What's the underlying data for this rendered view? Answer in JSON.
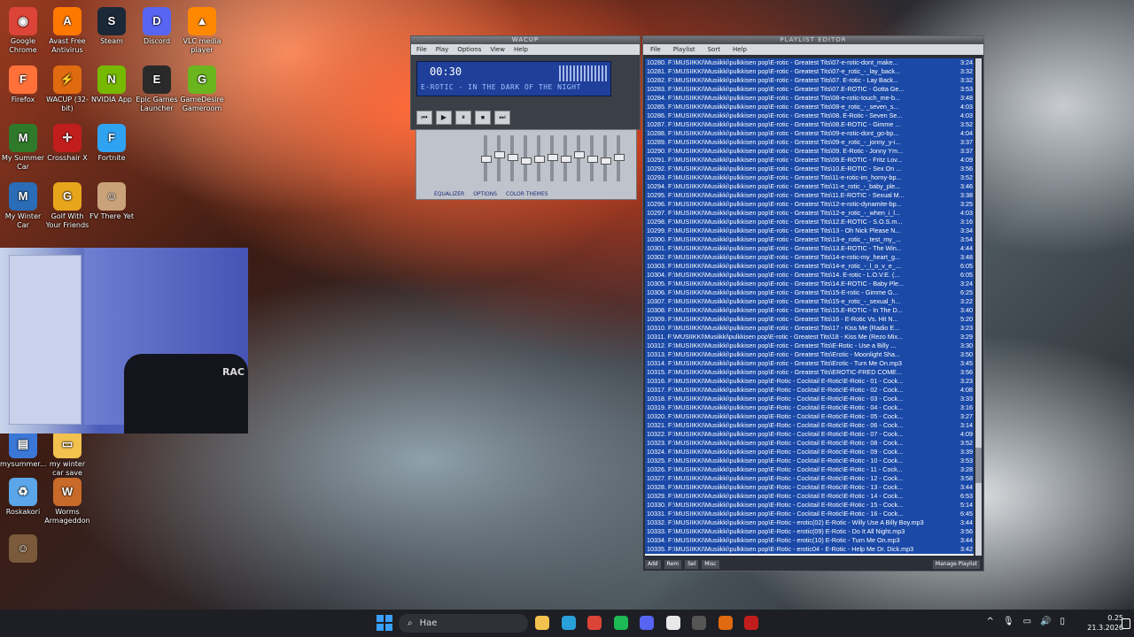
{
  "desktop": {
    "icons": [
      {
        "label": "Google Chrome",
        "icon": "chrome-icon",
        "color": "#db4437",
        "glyph": "◉"
      },
      {
        "label": "Avast Free Antivirus",
        "icon": "avast-icon",
        "color": "#ff7800",
        "glyph": "A"
      },
      {
        "label": "Steam",
        "icon": "steam-icon",
        "color": "#1b2838",
        "glyph": "S"
      },
      {
        "label": "Discord",
        "icon": "discord-icon",
        "color": "#5865f2",
        "glyph": "D"
      },
      {
        "label": "VLC media player",
        "icon": "vlc-icon",
        "color": "#ff8800",
        "glyph": "▲"
      },
      {
        "label": "Firefox",
        "icon": "firefox-icon",
        "color": "#ff7139",
        "glyph": "F"
      },
      {
        "label": "WACUP (32-bit)",
        "icon": "wacup-icon",
        "color": "#e06a10",
        "glyph": "⚡"
      },
      {
        "label": "NVIDIA App",
        "icon": "nvidia-icon",
        "color": "#76b900",
        "glyph": "N"
      },
      {
        "label": "Epic Games Launcher",
        "icon": "epic-icon",
        "color": "#2a2a2a",
        "glyph": "E"
      },
      {
        "label": "GameDesire Gameroom",
        "icon": "gamedesire-icon",
        "color": "#6bb51f",
        "glyph": "G"
      },
      {
        "label": "My Summer Car",
        "icon": "mysummercar-icon",
        "color": "#2f7a2a",
        "glyph": "M"
      },
      {
        "label": "Crosshair X",
        "icon": "crosshair-icon",
        "color": "#c21d1d",
        "glyph": "✛"
      },
      {
        "label": "Fortnite",
        "icon": "fortnite-icon",
        "color": "#2fa3f2",
        "glyph": "F"
      },
      {
        "label": "My Winter Car",
        "icon": "mywintercar-icon",
        "color": "#2a6cb5",
        "glyph": "M"
      },
      {
        "label": "Golf With Your Friends",
        "icon": "golf-icon",
        "color": "#e7a51c",
        "glyph": "G"
      },
      {
        "label": "FV There Yet",
        "icon": "game-icon",
        "color": "#c9a27a",
        "glyph": "☺"
      },
      {
        "label": "mysummer...",
        "icon": "file-icon",
        "color": "#3a77d6",
        "glyph": "▤"
      },
      {
        "label": "my winter car save",
        "icon": "folder-icon",
        "color": "#f2c14e",
        "glyph": "▭"
      },
      {
        "label": "Roskakori",
        "icon": "recycle-bin-icon",
        "color": "#5aa6e8",
        "glyph": "♻"
      },
      {
        "label": "Worms Armageddon",
        "icon": "worms-icon",
        "color": "#c86a2a",
        "glyph": "W"
      },
      {
        "label": "",
        "icon": "game-icon",
        "color": "#7a5a3a",
        "glyph": "☺"
      }
    ]
  },
  "webcam": {
    "label": "RAC"
  },
  "winamp": {
    "title": "WACUP",
    "menu": [
      "File",
      "Play",
      "Options",
      "View",
      "Help"
    ],
    "time": "00:30",
    "song": "E-ROTIC - IN THE DARK OF THE NIGHT",
    "controls": [
      "⏮",
      "▶",
      "⏸",
      "⏹",
      "⏭"
    ],
    "eq_labels": [
      "EQUALIZER",
      "OPTIONS",
      "COLOR THEMES"
    ],
    "eq_levels": [
      0.5,
      0.6,
      0.55,
      0.45,
      0.5,
      0.55,
      0.5,
      0.6,
      0.5,
      0.45,
      0.55
    ]
  },
  "playlist": {
    "title": "PLAYLIST EDITOR",
    "menu": [
      "File",
      "Playlist",
      "Sort",
      "Help"
    ],
    "rows": [
      {
        "t": "10280. F:\\MUSIIKKI\\Musiikki\\pulkkisen pop\\E-rotic - Greatest Tits\\07-e-rotic-dont_make...",
        "d": "3:24"
      },
      {
        "t": "10281. F:\\MUSIIKKI\\Musiikki\\pulkkisen pop\\E-rotic - Greatest Tits\\07-e_rotic_-_lay_back...",
        "d": "3:32"
      },
      {
        "t": "10282. F:\\MUSIIKKI\\Musiikki\\pulkkisen pop\\E-rotic - Greatest Tits\\07. E-rotic - Lay Back...",
        "d": "3:32"
      },
      {
        "t": "10283. F:\\MUSIIKKI\\Musiikki\\pulkkisen pop\\E-rotic - Greatest Tits\\07.E-ROTIC - Gotta Ge...",
        "d": "3:53"
      },
      {
        "t": "10284. F:\\MUSIIKKI\\Musiikki\\pulkkisen pop\\E-rotic - Greatest Tits\\08-e-rotic-touch_me-b...",
        "d": "3:48"
      },
      {
        "t": "10285. F:\\MUSIIKKI\\Musiikki\\pulkkisen pop\\E-rotic - Greatest Tits\\08-e_rotic_-_seven_s...",
        "d": "4:03"
      },
      {
        "t": "10286. F:\\MUSIIKKI\\Musiikki\\pulkkisen pop\\E-rotic - Greatest Tits\\08. E-Rotic - Seven Se...",
        "d": "4:03"
      },
      {
        "t": "10287. F:\\MUSIIKKI\\Musiikki\\pulkkisen pop\\E-rotic - Greatest Tits\\08.E-ROTIC - Gimme ...",
        "d": "3:52"
      },
      {
        "t": "10288. F:\\MUSIIKKI\\Musiikki\\pulkkisen pop\\E-rotic - Greatest Tits\\09-e-rotic-dont_go-bp...",
        "d": "4:04"
      },
      {
        "t": "10289. F:\\MUSIIKKI\\Musiikki\\pulkkisen pop\\E-rotic - Greatest Tits\\09-e_rotic_-_jonny_y-i...",
        "d": "3:37"
      },
      {
        "t": "10290. F:\\MUSIIKKI\\Musiikki\\pulkkisen pop\\E-rotic - Greatest Tits\\09. E-Rotic - Jonny Ym...",
        "d": "3:37"
      },
      {
        "t": "10291. F:\\MUSIIKKI\\Musiikki\\pulkkisen pop\\E-rotic - Greatest Tits\\09.E-ROTIC - Fritz Lov...",
        "d": "4:09"
      },
      {
        "t": "10292. F:\\MUSIIKKI\\Musiikki\\pulkkisen pop\\E-rotic - Greatest Tits\\10.E-ROTIC - Sex On ...",
        "d": "3:56"
      },
      {
        "t": "10293. F:\\MUSIIKKI\\Musiikki\\pulkkisen pop\\E-rotic - Greatest Tits\\11-e-rotic-im_horny-bp...",
        "d": "3:52"
      },
      {
        "t": "10294. F:\\MUSIIKKI\\Musiikki\\pulkkisen pop\\E-rotic - Greatest Tits\\11-e_rotic_-_baby_ple...",
        "d": "3:46"
      },
      {
        "t": "10295. F:\\MUSIIKKI\\Musiikki\\pulkkisen pop\\E-rotic - Greatest Tits\\11.E-ROTIC - Sexual M...",
        "d": "3:38"
      },
      {
        "t": "10296. F:\\MUSIIKKI\\Musiikki\\pulkkisen pop\\E-rotic - Greatest Tits\\12-e-rotic-dynamite-bp...",
        "d": "3:25"
      },
      {
        "t": "10297. F:\\MUSIIKKI\\Musiikki\\pulkkisen pop\\E-rotic - Greatest Tits\\12-e_rotic_-_when_i_l...",
        "d": "4:03"
      },
      {
        "t": "10298. F:\\MUSIIKKI\\Musiikki\\pulkkisen pop\\E-rotic - Greatest Tits\\12.E-ROTIC - S.O.S.m...",
        "d": "3:16"
      },
      {
        "t": "10299. F:\\MUSIIKKI\\Musiikki\\pulkkisen pop\\E-rotic - Greatest Tits\\13 - Oh Nick Please N...",
        "d": "3:34"
      },
      {
        "t": "10300. F:\\MUSIIKKI\\Musiikki\\pulkkisen pop\\E-rotic - Greatest Tits\\13-e_rotic_-_test_my_...",
        "d": "3:54"
      },
      {
        "t": "10301. F:\\MUSIIKKI\\Musiikki\\pulkkisen pop\\E-rotic - Greatest Tits\\13.E-ROTIC - The Win...",
        "d": "4:44"
      },
      {
        "t": "10302. F:\\MUSIIKKI\\Musiikki\\pulkkisen pop\\E-rotic - Greatest Tits\\14-e-rotic-my_heart_g...",
        "d": "3:48"
      },
      {
        "t": "10303. F:\\MUSIIKKI\\Musiikki\\pulkkisen pop\\E-rotic - Greatest Tits\\14-e_rotic_-_l_o_v_e_...",
        "d": "6:05"
      },
      {
        "t": "10304. F:\\MUSIIKKI\\Musiikki\\pulkkisen pop\\E-rotic - Greatest Tits\\14. E-rotic - L.O.V.E. (...",
        "d": "6:05"
      },
      {
        "t": "10305. F:\\MUSIIKKI\\Musiikki\\pulkkisen pop\\E-rotic - Greatest Tits\\14.E-ROTIC - Baby Ple...",
        "d": "3:24"
      },
      {
        "t": "10306. F:\\MUSIIKKI\\Musiikki\\pulkkisen pop\\E-rotic - Greatest Tits\\15-E-rotic - Gimme G...",
        "d": "6:25"
      },
      {
        "t": "10307. F:\\MUSIIKKI\\Musiikki\\pulkkisen pop\\E-rotic - Greatest Tits\\15-e_rotic_-_sexual_h...",
        "d": "3:22"
      },
      {
        "t": "10308. F:\\MUSIIKKI\\Musiikki\\pulkkisen pop\\E-rotic - Greatest Tits\\15.E-ROTIC - In The D...",
        "d": "3:40"
      },
      {
        "t": "10309. F:\\MUSIIKKI\\Musiikki\\pulkkisen pop\\E-rotic - Greatest Tits\\16 - E-Rotic Vs. Hit N...",
        "d": "5:20"
      },
      {
        "t": "10310. F:\\MUSIIKKI\\Musiikki\\pulkkisen pop\\E-rotic - Greatest Tits\\17 - Kiss Me (Radio E...",
        "d": "3:23"
      },
      {
        "t": "10311. F:\\MUSIIKKI\\Musiikki\\pulkkisen pop\\E-rotic - Greatest Tits\\18 - Kiss Me (Rezo Mix...",
        "d": "3:29"
      },
      {
        "t": "10312. F:\\MUSIIKKI\\Musiikki\\pulkkisen pop\\E-rotic - Greatest Tits\\E-Rotic - Use a Billy ...",
        "d": "3:30"
      },
      {
        "t": "10313. F:\\MUSIIKKI\\Musiikki\\pulkkisen pop\\E-rotic - Greatest Tits\\Erotic - Moonlight Sha...",
        "d": "3:50"
      },
      {
        "t": "10314. F:\\MUSIIKKI\\Musiikki\\pulkkisen pop\\E-rotic - Greatest Tits\\Erotic - Turn Me On.mp3",
        "d": "3:45"
      },
      {
        "t": "10315. F:\\MUSIIKKI\\Musiikki\\pulkkisen pop\\E-rotic - Greatest Tits\\EROTIC-FRED COME...",
        "d": "3:56"
      },
      {
        "t": "10316. F:\\MUSIIKKI\\Musiikki\\pulkkisen pop\\E-Rotic - Cocktail E-Rotic\\E-Rotic - 01 - Cock...",
        "d": "3:23"
      },
      {
        "t": "10317. F:\\MUSIIKKI\\Musiikki\\pulkkisen pop\\E-Rotic - Cocktail E-Rotic\\E-Rotic - 02 - Cock...",
        "d": "4:08"
      },
      {
        "t": "10318. F:\\MUSIIKKI\\Musiikki\\pulkkisen pop\\E-Rotic - Cocktail E-Rotic\\E-Rotic - 03 - Cock...",
        "d": "3:33"
      },
      {
        "t": "10319. F:\\MUSIIKKI\\Musiikki\\pulkkisen pop\\E-Rotic - Cocktail E-Rotic\\E-Rotic - 04 - Cock...",
        "d": "3:16"
      },
      {
        "t": "10320. F:\\MUSIIKKI\\Musiikki\\pulkkisen pop\\E-Rotic - Cocktail E-Rotic\\E-Rotic - 05 - Cock...",
        "d": "3:27"
      },
      {
        "t": "10321. F:\\MUSIIKKI\\Musiikki\\pulkkisen pop\\E-Rotic - Cocktail E-Rotic\\E-Rotic - 06 - Cock...",
        "d": "3:14"
      },
      {
        "t": "10322. F:\\MUSIIKKI\\Musiikki\\pulkkisen pop\\E-Rotic - Cocktail E-Rotic\\E-Rotic - 07 - Cock...",
        "d": "4:09"
      },
      {
        "t": "10323. F:\\MUSIIKKI\\Musiikki\\pulkkisen pop\\E-Rotic - Cocktail E-Rotic\\E-Rotic - 08 - Cock...",
        "d": "3:52"
      },
      {
        "t": "10324. F:\\MUSIIKKI\\Musiikki\\pulkkisen pop\\E-Rotic - Cocktail E-Rotic\\E-Rotic - 09 - Cock...",
        "d": "3:39"
      },
      {
        "t": "10325. F:\\MUSIIKKI\\Musiikki\\pulkkisen pop\\E-Rotic - Cocktail E-Rotic\\E-Rotic - 10 - Cock...",
        "d": "3:53"
      },
      {
        "t": "10326. F:\\MUSIIKKI\\Musiikki\\pulkkisen pop\\E-Rotic - Cocktail E-Rotic\\E-Rotic - 11 - Cock...",
        "d": "3:28"
      },
      {
        "t": "10327. F:\\MUSIIKKI\\Musiikki\\pulkkisen pop\\E-Rotic - Cocktail E-Rotic\\E-Rotic - 12 - Cock...",
        "d": "3:58"
      },
      {
        "t": "10328. F:\\MUSIIKKI\\Musiikki\\pulkkisen pop\\E-Rotic - Cocktail E-Rotic\\E-Rotic - 13 - Cock...",
        "d": "3:44"
      },
      {
        "t": "10329. F:\\MUSIIKKI\\Musiikki\\pulkkisen pop\\E-Rotic - Cocktail E-Rotic\\E-Rotic - 14 - Cock...",
        "d": "6:53"
      },
      {
        "t": "10330. F:\\MUSIIKKI\\Musiikki\\pulkkisen pop\\E-Rotic - Cocktail E-Rotic\\E-Rotic - 15 - Cock...",
        "d": "5:14"
      },
      {
        "t": "10331. F:\\MUSIIKKI\\Musiikki\\pulkkisen pop\\E-Rotic - Cocktail E-Rotic\\E-Rotic - 16 - Cock...",
        "d": "6:45"
      },
      {
        "t": "10332. F:\\MUSIIKKI\\Musiikki\\pulkkisen pop\\E-Rotic - erotic(02) E-Rotic - Willy Use A Billy Boy.mp3",
        "d": "3:44"
      },
      {
        "t": "10333. F:\\MUSIIKKI\\Musiikki\\pulkkisen pop\\E-Rotic - erotic(09) E-Rotic - Do It All Night.mp3",
        "d": "3:56"
      },
      {
        "t": "10334. F:\\MUSIIKKI\\Musiikki\\pulkkisen pop\\E-Rotic - erotic(10) E-Rotic - Turn Me On.mp3",
        "d": "3:44"
      },
      {
        "t": "10335. F:\\MUSIIKKI\\Musiikki\\pulkkisen pop\\E-Rotic - erotic04 - E-Rotic - Help Me Dr. Dick.mp3",
        "d": "3:42"
      }
    ],
    "footer": [
      "Add",
      "Rem",
      "Sel",
      "Misc",
      "Manage Playlist"
    ]
  },
  "taskbar": {
    "search_placeholder": "Hae",
    "apps": [
      {
        "icon": "file-explorer-icon",
        "color": "#f2c14e"
      },
      {
        "icon": "edge-icon",
        "color": "#2aa0d8"
      },
      {
        "icon": "chrome-icon",
        "color": "#db4437"
      },
      {
        "icon": "spotify-icon",
        "color": "#1db954"
      },
      {
        "icon": "discord-icon",
        "color": "#5865f2"
      },
      {
        "icon": "obs-icon",
        "color": "#e8e8e8"
      },
      {
        "icon": "epic-icon",
        "color": "#555555"
      },
      {
        "icon": "wacup-icon",
        "color": "#e06a10"
      },
      {
        "icon": "crosshair-icon",
        "color": "#c21d1d"
      }
    ],
    "tray": {
      "time": "0.25",
      "date": "21.3.2026"
    }
  }
}
